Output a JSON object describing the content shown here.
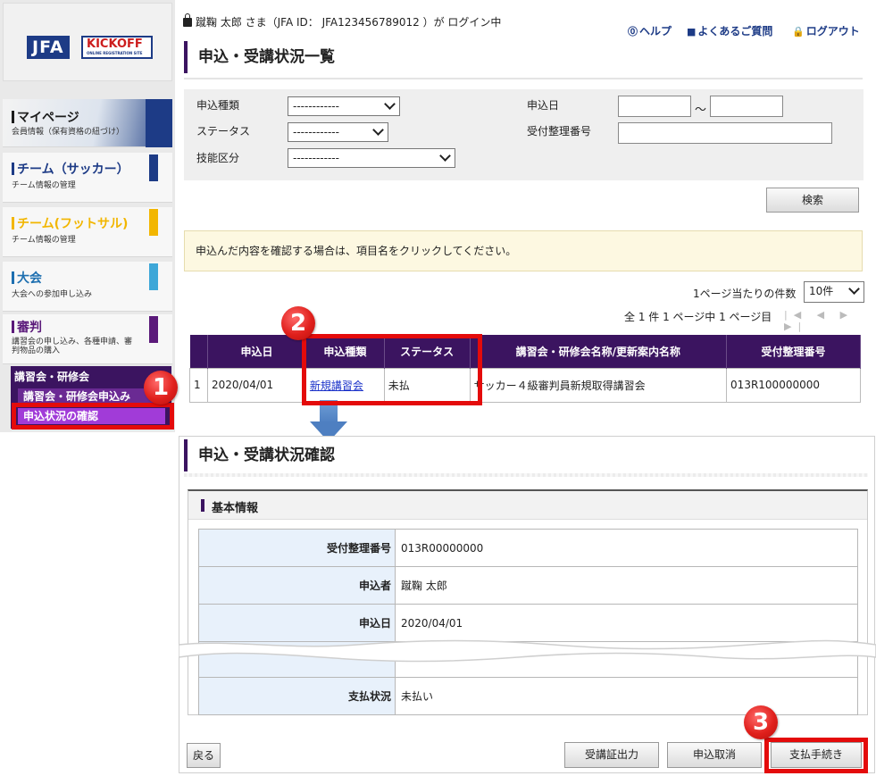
{
  "brand": {
    "jfa": "JFA",
    "kickoff": "KICKOFF",
    "kickoff_sub": "ONLINE REGISTRATION SITE"
  },
  "sidebar": {
    "items": [
      {
        "label": "マイページ",
        "sub": "会員情報（保有資格の紐づけ）"
      },
      {
        "label": "チーム（サッカー）",
        "sub": "チーム情報の管理"
      },
      {
        "label": "チーム(フットサル)",
        "sub": "チーム情報の管理"
      },
      {
        "label": "大会",
        "sub": "大会への参加申し込み"
      },
      {
        "label": "審判",
        "sub": "講習会の申し込み、各種申請、審判物品の購入"
      }
    ],
    "submenu": {
      "heading": "講習会・研修会",
      "items": [
        "講習会・研修会申込み",
        "申込状況の確認"
      ]
    }
  },
  "header": {
    "login_info": "蹴鞠 太郎 さま（JFA ID： JFA123456789012 ）が ログイン中",
    "help": "ヘルプ",
    "faq": "よくあるご質問",
    "logout": "ログアウト"
  },
  "list_page": {
    "title": "申込・受講状況一覧",
    "filters": {
      "app_type_label": "申込種類",
      "app_type_value": "------------",
      "status_label": "ステータス",
      "status_value": "------------",
      "skill_label": "技能区分",
      "skill_value": "------------",
      "date_label": "申込日",
      "date_sep": "～",
      "receipt_label": "受付整理番号"
    },
    "search_button": "検索",
    "notice": "申込んだ内容を確認する場合は、項目名をクリックしてください。",
    "per_page_label": "1ページ当たりの件数",
    "per_page_value": "10件",
    "pager_text": "全 1 件 1 ページ中 1 ページ目",
    "pager_nav": "|◀ ◀ ▶ ▶|",
    "table": {
      "headers": [
        "",
        "申込日",
        "申込種類",
        "ステータス",
        "講習会・研修会名称/更新案内名称",
        "受付整理番号"
      ],
      "rows": [
        {
          "no": "1",
          "date": "2020/04/01",
          "type": "新規講習会",
          "status": "未払",
          "name": "サッカー４級審判員新規取得講習会",
          "receipt": "013R100000000"
        }
      ]
    }
  },
  "detail_page": {
    "title": "申込・受講状況確認",
    "section_title": "基本情報",
    "rows": [
      {
        "label": "受付整理番号",
        "value": "013R00000000"
      },
      {
        "label": "申込者",
        "value": "蹴鞠 太郎"
      },
      {
        "label": "申込日",
        "value": "2020/04/01"
      },
      {
        "label": "支払状況",
        "value": "未払い"
      }
    ],
    "buttons": {
      "back": "戻る",
      "certificate": "受講証出力",
      "cancel": "申込取消",
      "pay": "支払手続き"
    }
  },
  "annotations": {
    "step1": "1",
    "step2": "2",
    "step3": "3"
  },
  "colors": {
    "accent": "#3b1460",
    "highlight": "#e40b0b",
    "brand_blue": "#1d3b86",
    "link": "#1a31c9"
  }
}
